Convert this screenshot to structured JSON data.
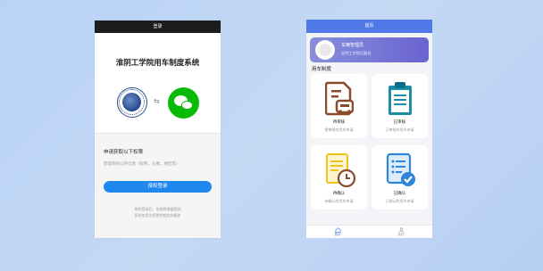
{
  "login_screen": {
    "title_bar": "登录",
    "heading": "淮阴工学院用车制度系统",
    "arrow": "⇆",
    "auth_title": "申请获取以下权限",
    "auth_desc": "获得你的公开信息（昵称，头像，地区等）",
    "login_button": "授权登录",
    "notice_line1": "授权登录后，系统将根据您的",
    "notice_line2": "身份信息为您提供相应的服务"
  },
  "home_screen": {
    "title_bar": "首页",
    "user_name": "车辆管理员",
    "user_subtitle": "淮阴工学院后勤处",
    "section_title": "用车制度",
    "tiles": [
      {
        "label": "待审核",
        "desc": "需审核的用车申请"
      },
      {
        "label": "已审核",
        "desc": "已审核的用车申请"
      },
      {
        "label": "待确认",
        "desc": "待确认的用车申请"
      },
      {
        "label": "已确认",
        "desc": "已确认的用车申请"
      }
    ],
    "tabs": [
      {
        "label": "首页",
        "icon": "home-icon"
      },
      {
        "label": "我的",
        "icon": "user-icon"
      }
    ]
  },
  "colors": {
    "background": "#bcd4f5",
    "login_button": "#1e88ef",
    "wechat_green": "#09bb07",
    "home_title_bar": "#4f79e6",
    "user_card": "#7678d6",
    "tile_icon_brown": "#8b4a2b",
    "tile_icon_teal": "#1b8fa6",
    "tile_icon_yellow": "#f0c419",
    "tile_icon_blue": "#2d86d8"
  }
}
